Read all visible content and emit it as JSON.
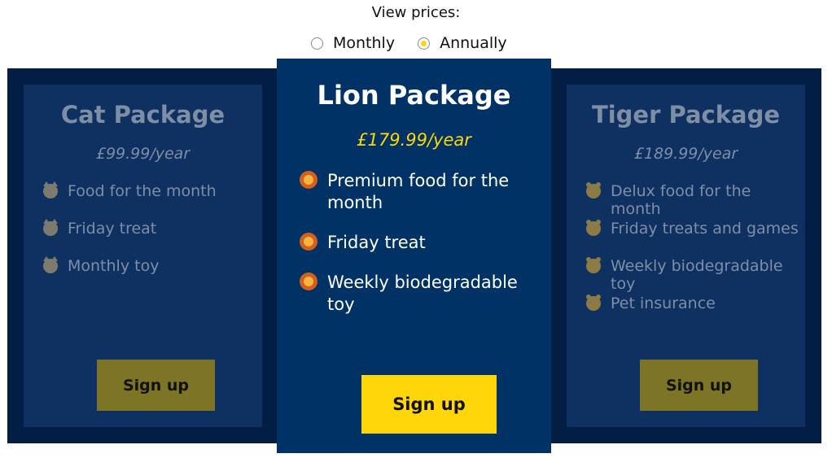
{
  "billing": {
    "heading": "View prices:",
    "options": [
      "Monthly",
      "Annually"
    ],
    "selected": "Annually"
  },
  "packages": [
    {
      "name": "Cat Package",
      "price": "£99.99/year",
      "icon": "cat-face-icon",
      "features": [
        "Food for the month",
        "Friday treat",
        "Monthly toy"
      ],
      "cta": "Sign up"
    },
    {
      "name": "Lion Package",
      "price": "£179.99/year",
      "icon": "lion-face-icon",
      "features": [
        "Premium food for the month",
        "Friday treat",
        "Weekly biodegradable toy"
      ],
      "cta": "Sign up"
    },
    {
      "name": "Tiger Package",
      "price": "£189.99/year",
      "icon": "tiger-face-icon",
      "features": [
        "Delux food for the month",
        "Friday treats and games",
        "Weekly biodegradable toy",
        "Pet insurance"
      ],
      "cta": "Sign up"
    }
  ],
  "colors": {
    "accent": "#ffd60a",
    "band_background": "#031e45",
    "card_background": "#0e3162",
    "featured_card_background": "#003266",
    "muted_button": "#7e7425"
  }
}
